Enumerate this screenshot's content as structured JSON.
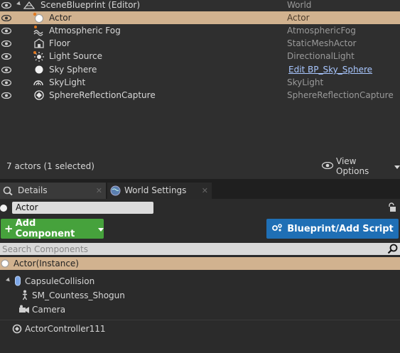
{
  "outliner": {
    "rows": [
      {
        "label": "SceneBlueprint (Editor)",
        "type": "World",
        "icon": "world-icon",
        "indent": 1,
        "expanded": true
      },
      {
        "label": "Actor",
        "type": "Actor",
        "icon": "actor-sphere-icon",
        "indent": 2,
        "selected": true
      },
      {
        "label": "Atmospheric Fog",
        "type": "AtmosphericFog",
        "icon": "fog-icon",
        "indent": 2
      },
      {
        "label": "Floor",
        "type": "StaticMeshActor",
        "icon": "static-mesh-icon",
        "indent": 2
      },
      {
        "label": "Light Source",
        "type": "DirectionalLight",
        "icon": "directional-light-icon",
        "indent": 2
      },
      {
        "label": "Sky Sphere",
        "type": "Edit BP_Sky_Sphere",
        "icon": "sphere-icon",
        "indent": 2,
        "link": true
      },
      {
        "label": "SkyLight",
        "type": "SkyLight",
        "icon": "skylight-icon",
        "indent": 2
      },
      {
        "label": "SphereReflectionCapture",
        "type": "SphereReflectionCapture",
        "icon": "reflection-capture-icon",
        "indent": 2
      }
    ],
    "footer": {
      "count": "7 actors (1 selected)",
      "view_options": "View Options"
    }
  },
  "tabs": [
    {
      "label": "Details",
      "icon": "details-icon",
      "active": true
    },
    {
      "label": "World Settings",
      "icon": "world-settings-icon",
      "active": false
    }
  ],
  "details": {
    "name_value": "Actor",
    "add_component_label": "Add Component",
    "blueprint_label": "Blueprint/Add Script",
    "search_placeholder": "Search Components",
    "instance_label": "Actor(Instance)",
    "components": [
      {
        "label": "CapsuleCollision",
        "icon": "capsule-icon"
      },
      {
        "label": "SM_Countess_Shogun",
        "icon": "skeletal-mesh-icon"
      },
      {
        "label": "Camera",
        "icon": "camera-icon"
      }
    ],
    "extra_component": {
      "label": "ActorController111",
      "icon": "actor-controller-icon"
    }
  },
  "colors": {
    "selection": "#d1b28f",
    "add_component_bg": "#46a23c",
    "blueprint_bg": "#1f6fb5",
    "link": "#a9c7ff"
  }
}
